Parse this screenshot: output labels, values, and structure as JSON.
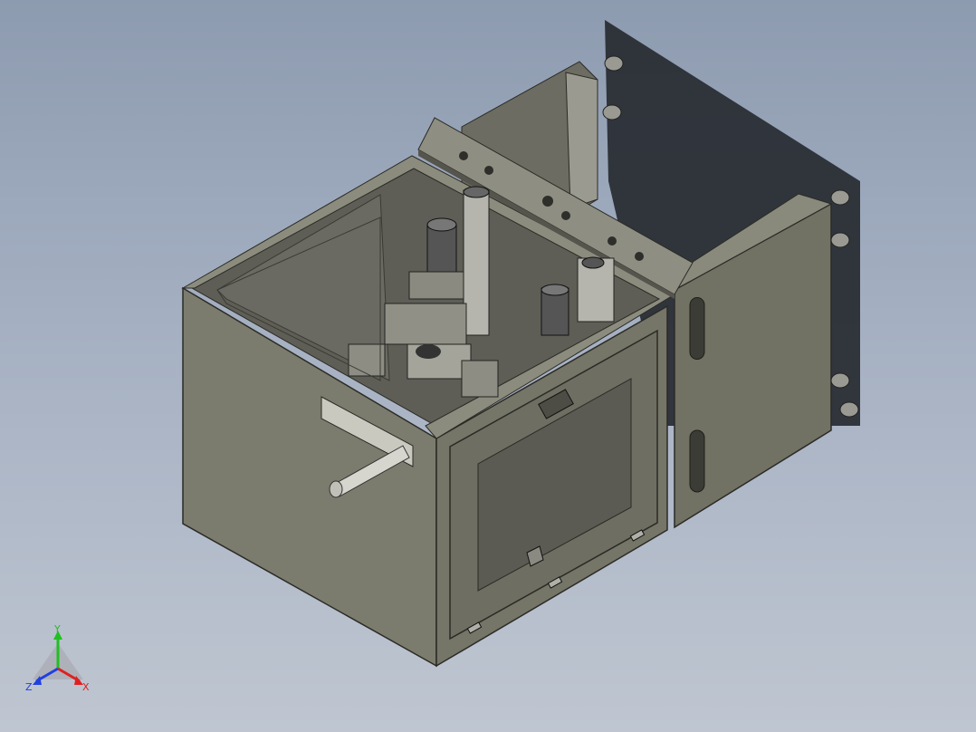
{
  "triad": {
    "x_label": "X",
    "y_label": "Y",
    "z_label": "Z",
    "x_color": "#e02020",
    "y_color": "#20c020",
    "z_color": "#2040e0"
  },
  "colors": {
    "background_top": "#8d9bb0",
    "background_bottom": "#bfc6d1",
    "housing_front": "#7c7c6e",
    "housing_side": "#717164",
    "housing_interior": "#5e5e56",
    "door_shadow": "#2a2e35"
  }
}
